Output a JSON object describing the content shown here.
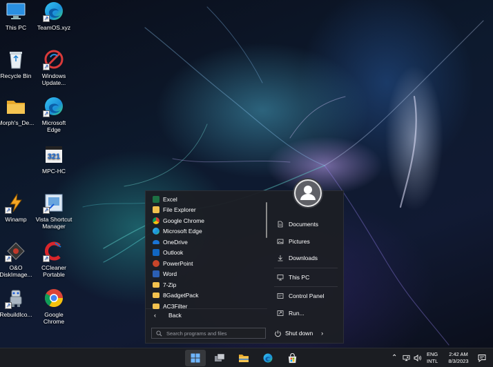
{
  "desktop": {
    "icons": [
      {
        "name": "this-pc",
        "label": "This PC",
        "icon": "monitor-icon"
      },
      {
        "name": "teamos",
        "label": "TeamOS.xyz",
        "icon": "edge-icon"
      },
      {
        "name": "recycle-bin",
        "label": "Recycle Bin",
        "icon": "recycle-bin-icon"
      },
      {
        "name": "windows-update",
        "label": "Windows\nUpdate...",
        "icon": "windows-update-blocked-icon"
      },
      {
        "name": "morphs-de",
        "label": "Morph's_De...",
        "icon": "folder-icon"
      },
      {
        "name": "microsoft-edge",
        "label": "Microsoft\nEdge",
        "icon": "edge-icon"
      },
      {
        "name": "mpc-hc",
        "label": "MPC-HC",
        "icon": "mpc-hc-icon"
      },
      {
        "name": "winamp",
        "label": "Winamp",
        "icon": "winamp-icon"
      },
      {
        "name": "vista-shortcut-manager",
        "label": "Vista Shortcut\nManager",
        "icon": "shortcut-manager-icon"
      },
      {
        "name": "oo-diskimage",
        "label": "O&O\nDiskImage...",
        "icon": "disk-image-icon"
      },
      {
        "name": "ccleaner",
        "label": "CCleaner\nPortable",
        "icon": "ccleaner-icon"
      },
      {
        "name": "rebuildico",
        "label": "RebuildIco...",
        "icon": "robot-icon"
      },
      {
        "name": "google-chrome",
        "label": "Google\nChrome",
        "icon": "chrome-icon"
      }
    ]
  },
  "start_menu": {
    "programs": [
      {
        "label": "Excel",
        "icon": "excel-icon",
        "color": "#1d7044"
      },
      {
        "label": "File Explorer",
        "icon": "file-explorer-icon",
        "color": "#f2c14e"
      },
      {
        "label": "Google Chrome",
        "icon": "chrome-icon",
        "color": "#db4437"
      },
      {
        "label": "Microsoft Edge",
        "icon": "edge-icon",
        "color": "#1fa2e0"
      },
      {
        "label": "OneDrive",
        "icon": "onedrive-icon",
        "color": "#1a74d6"
      },
      {
        "label": "Outlook",
        "icon": "outlook-icon",
        "color": "#1166c2"
      },
      {
        "label": "PowerPoint",
        "icon": "powerpoint-icon",
        "color": "#c8452a"
      },
      {
        "label": "Word",
        "icon": "word-icon",
        "color": "#2b5fb3"
      },
      {
        "label": "7-Zip",
        "icon": "folder-icon",
        "color": "#f2c14e"
      },
      {
        "label": "8GadgetPack",
        "icon": "folder-icon",
        "color": "#f2c14e"
      },
      {
        "label": "AC3Filter",
        "icon": "folder-icon",
        "color": "#f2c14e"
      }
    ],
    "back_label": "Back",
    "search_placeholder": "Search programs and files",
    "places": [
      {
        "label": "Documents",
        "icon": "document-icon"
      },
      {
        "label": "Pictures",
        "icon": "picture-icon"
      },
      {
        "label": "Downloads",
        "icon": "download-icon"
      },
      {
        "label": "This PC",
        "icon": "monitor-icon"
      },
      {
        "label": "Control Panel",
        "icon": "control-panel-icon"
      },
      {
        "label": "Run...",
        "icon": "run-icon"
      }
    ],
    "shutdown_label": "Shut down"
  },
  "taskbar": {
    "items": [
      {
        "name": "start",
        "icon": "windows-start-icon"
      },
      {
        "name": "task-view",
        "icon": "task-view-icon"
      },
      {
        "name": "file-explorer",
        "icon": "file-explorer-icon"
      },
      {
        "name": "edge",
        "icon": "edge-icon"
      },
      {
        "name": "store",
        "icon": "store-icon"
      }
    ],
    "tray": {
      "lang_top": "ENG",
      "lang_bottom": "INTL",
      "time": "2:42 AM",
      "date": "8/3/2023"
    }
  }
}
